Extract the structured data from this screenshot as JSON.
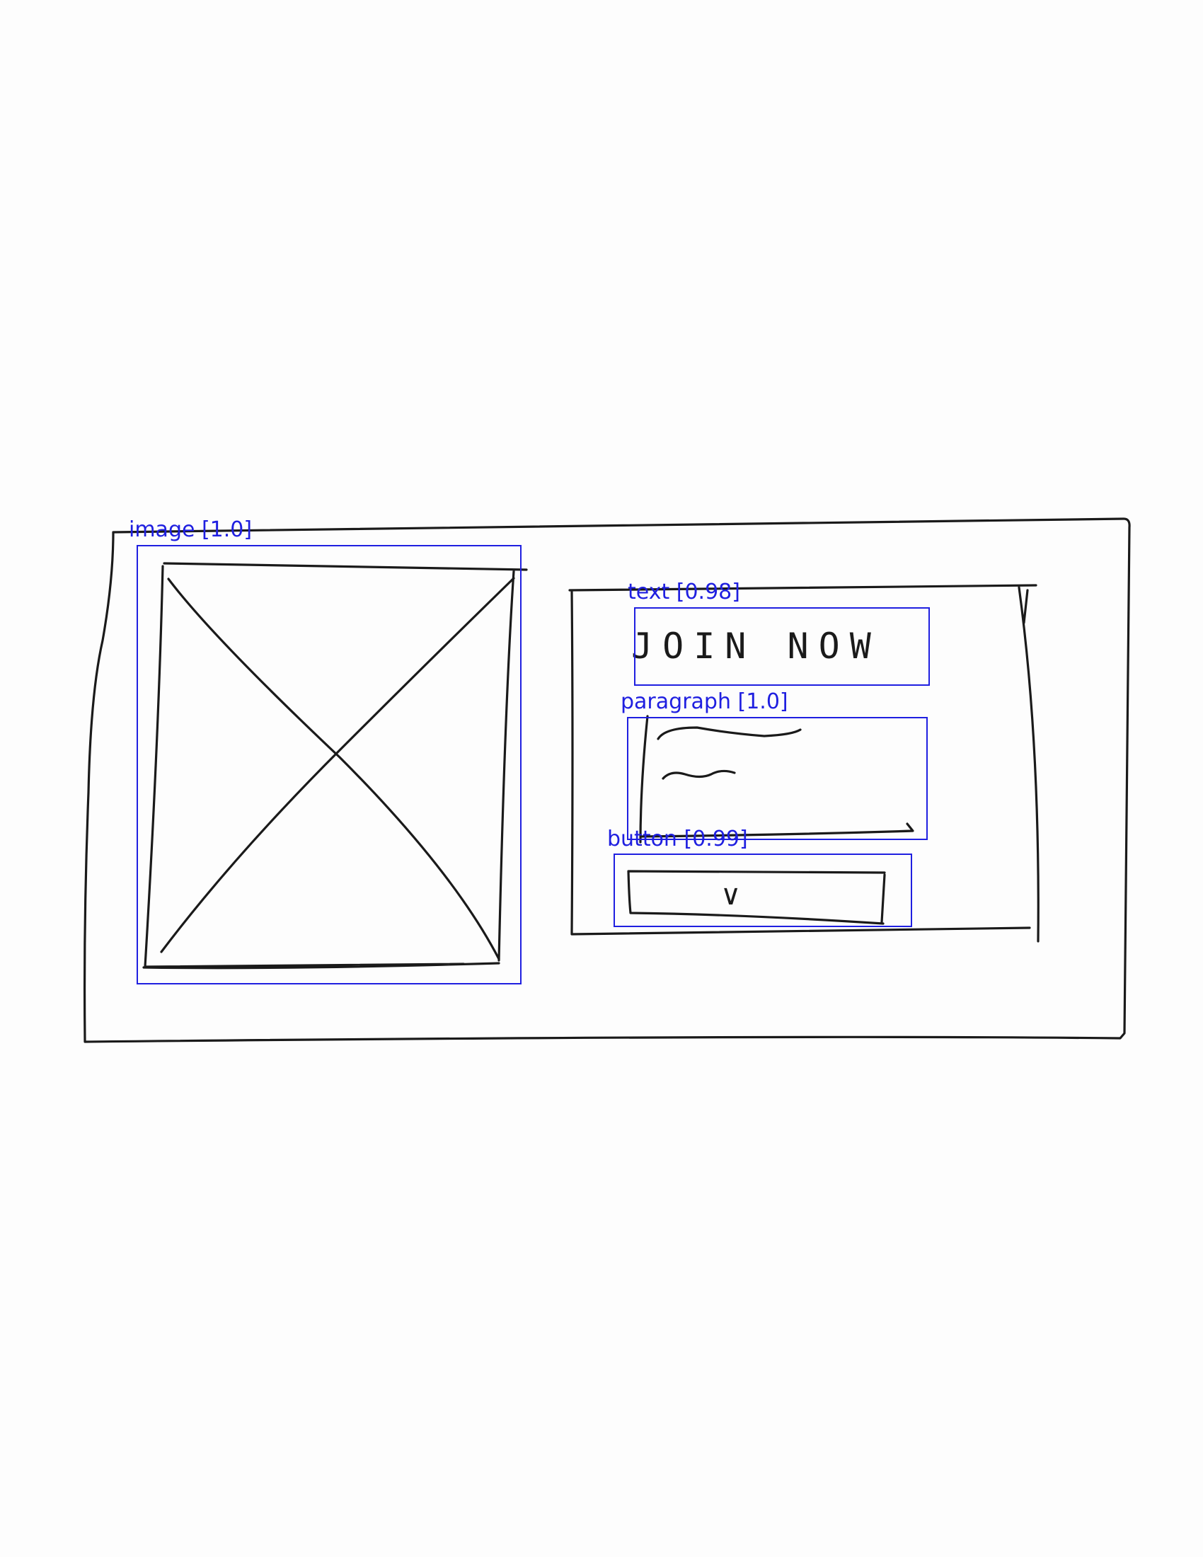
{
  "sketch": {
    "heading": "JOIN NOW",
    "button_icon": "chevron-down-icon",
    "button_glyph": "∨"
  },
  "detections": [
    {
      "class": "image",
      "score": "1.0",
      "label": "image [1.0]"
    },
    {
      "class": "text",
      "score": "0.98",
      "label": "text [0.98]"
    },
    {
      "class": "paragraph",
      "score": "1.0",
      "label": "paragraph [1.0]"
    },
    {
      "class": "button",
      "score": "0.99",
      "label": "button [0.99]"
    }
  ],
  "colors": {
    "ink": "#1a1a1a",
    "detection_box": "#1f1fe0",
    "paper": "#fdfdfd"
  }
}
